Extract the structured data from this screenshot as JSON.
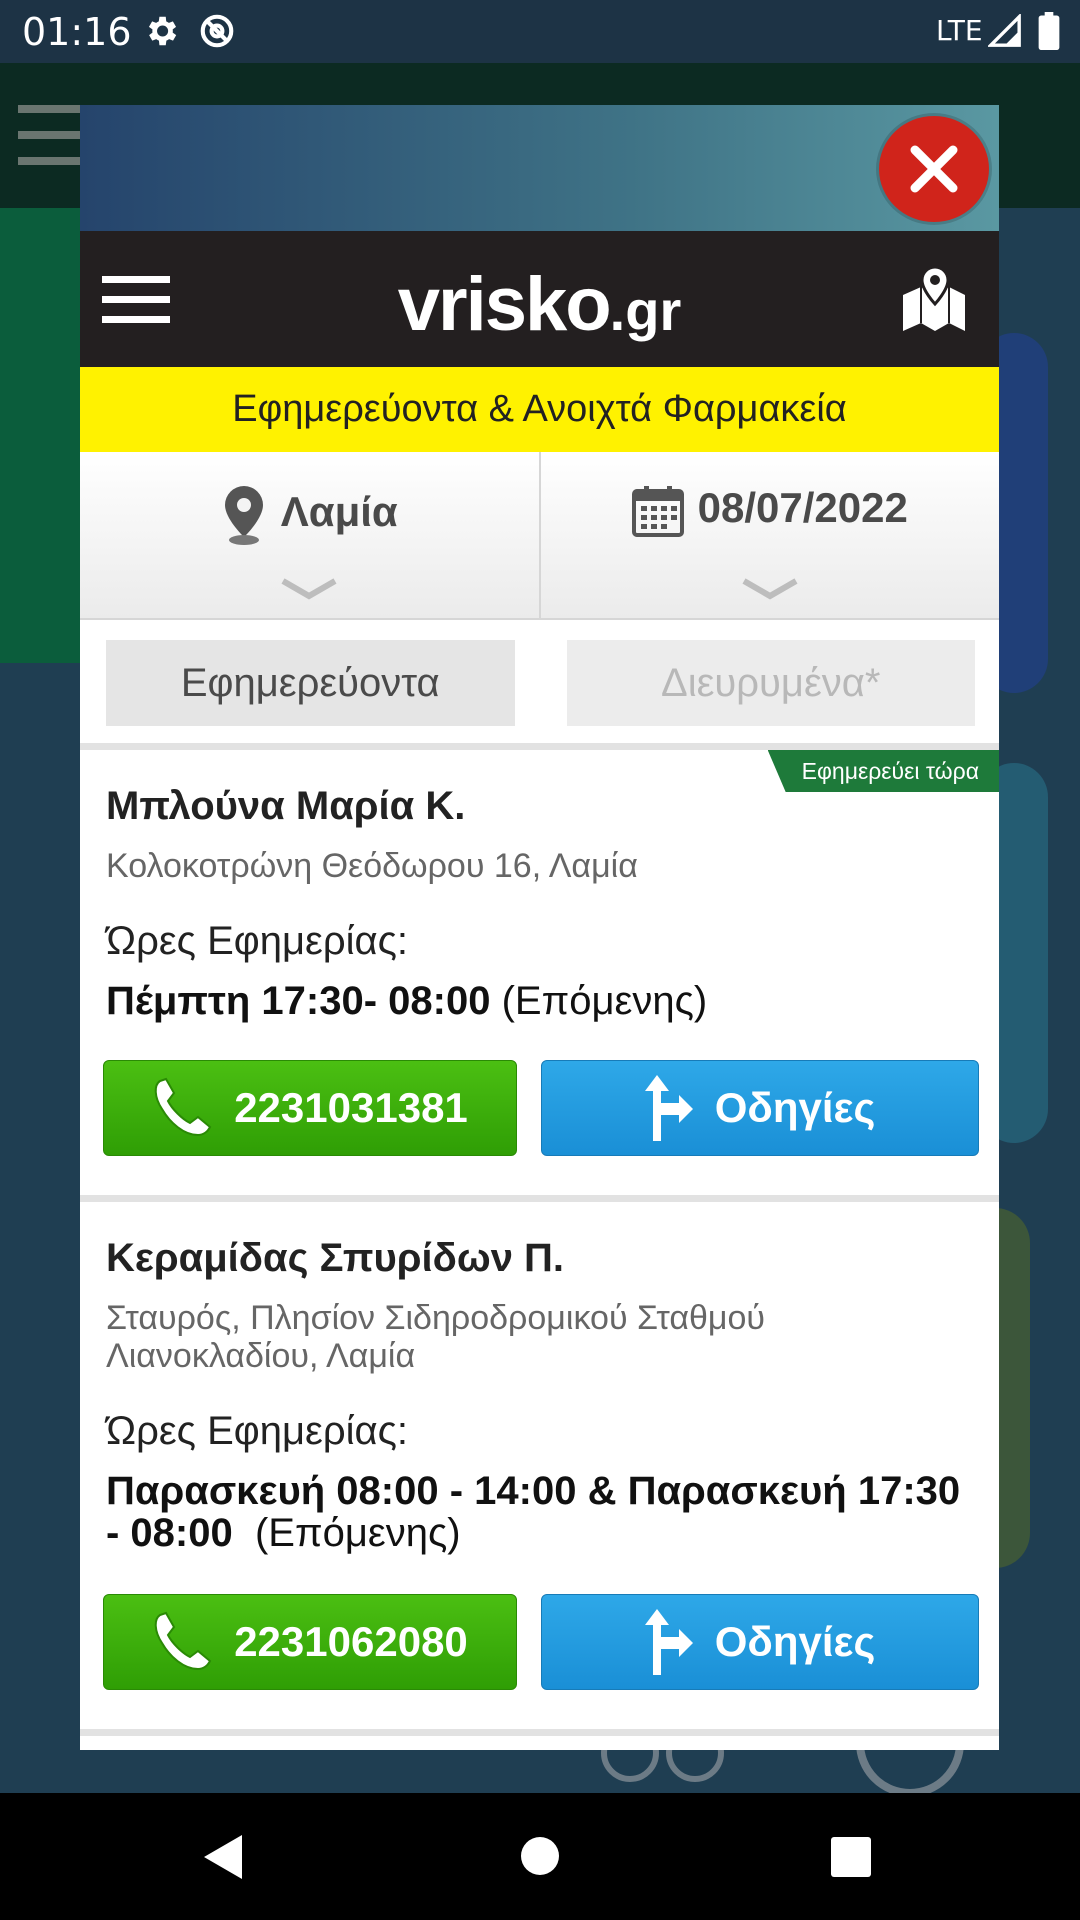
{
  "status_bar": {
    "time": "01:16",
    "network": "LTE",
    "icons": [
      "gear-icon",
      "at-sign-icon",
      "signal-icon",
      "battery-icon"
    ]
  },
  "modal": {
    "close_icon": "close-icon",
    "brand": {
      "logo_main": "vrisko",
      "logo_suffix": ".gr"
    },
    "banner_title": "Εφημερεύοντα & Ανοιχτά Φαρμακεία",
    "location": {
      "value": "Λαμία",
      "icon": "location-pin-icon"
    },
    "date": {
      "value": "08/07/2022",
      "icon": "calendar-icon"
    },
    "tabs": [
      {
        "label": "Εφημερεύοντα",
        "active": true
      },
      {
        "label": "Διευρυμένα*",
        "active": false
      }
    ],
    "pharmacies": [
      {
        "badge": "Εφημερεύει τώρα",
        "name": "Μπλούνα Μαρία Κ.",
        "address": "Κολοκοτρώνη Θεόδωρου 16, Λαμία",
        "hours_label": "Ώρες Εφημερίας:",
        "hours_bold": "Πέμπτη 17:30- 08:00",
        "hours_note": "(Επόμενης)",
        "phone": "2231031381",
        "directions": "Οδηγίες"
      },
      {
        "name": "Κεραμίδας Σπυρίδων Π.",
        "address": "Σταυρός, Πλησίον Σιδηροδρομικού Σταθμού Λιανοκλαδίου, Λαμία",
        "hours_label": "Ώρες Εφημερίας:",
        "hours_bold": "Παρασκευή 08:00 - 14:00 & Παρασκευή 17:30 - 08:00",
        "hours_note": "(Επόμενης)",
        "phone": "2231062080",
        "directions": "Οδηγίες"
      }
    ]
  },
  "colors": {
    "call_green": "#3aae0b",
    "directions_blue": "#2299e0",
    "banner_yellow": "#fff200",
    "close_red": "#d0241b",
    "badge_green": "#1e7a3a"
  }
}
